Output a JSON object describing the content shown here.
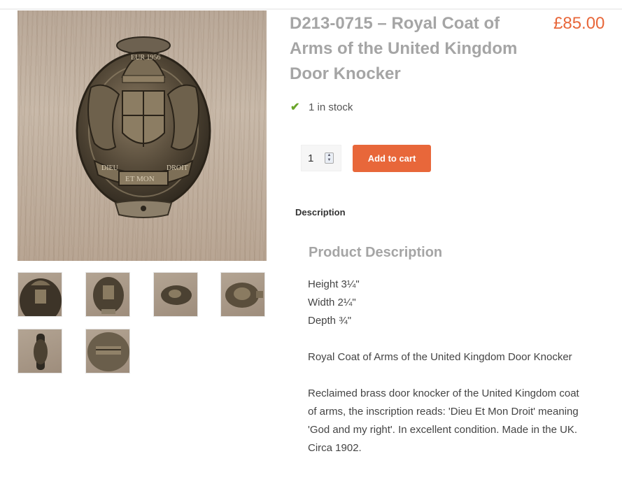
{
  "product": {
    "title": "D213-0715 – Royal Coat of Arms of the United Kingdom Door Knocker",
    "price": "£85.00",
    "stock_text": "1 in stock",
    "quantity": "1",
    "add_to_cart_label": "Add to cart",
    "main_image": {
      "name": "door-knocker-front-photo",
      "inscription_top": "EUR 1956",
      "inscription_bottom": "ET MON",
      "motto_left": "DIEU",
      "motto_right": "DROIT"
    },
    "thumbnails": [
      {
        "name": "thumb-front-closeup"
      },
      {
        "name": "thumb-front-full"
      },
      {
        "name": "thumb-side-view"
      },
      {
        "name": "thumb-angled-view"
      },
      {
        "name": "thumb-edge-view"
      },
      {
        "name": "thumb-back-view"
      }
    ]
  },
  "tabs": {
    "description_label": "Description"
  },
  "description": {
    "heading": "Product Description",
    "height": "Height 3¼\"",
    "width": "Width 2¼\"",
    "depth": "Depth ¾\"",
    "summary": "Royal Coat of Arms of the United Kingdom Door Knocker",
    "details": "Reclaimed brass door knocker of the United Kingdom coat of arms, the inscription reads: 'Dieu Et Mon Droit' meaning 'God and my right'. In excellent condition. Made in the UK. Circa 1902."
  },
  "colors": {
    "accent": "#e8673a",
    "title_gray": "#a5a5a5",
    "stock_check": "#6aa52a"
  },
  "icons": {
    "stock": "check-icon",
    "spinner": "spinner-arrows-icon"
  }
}
